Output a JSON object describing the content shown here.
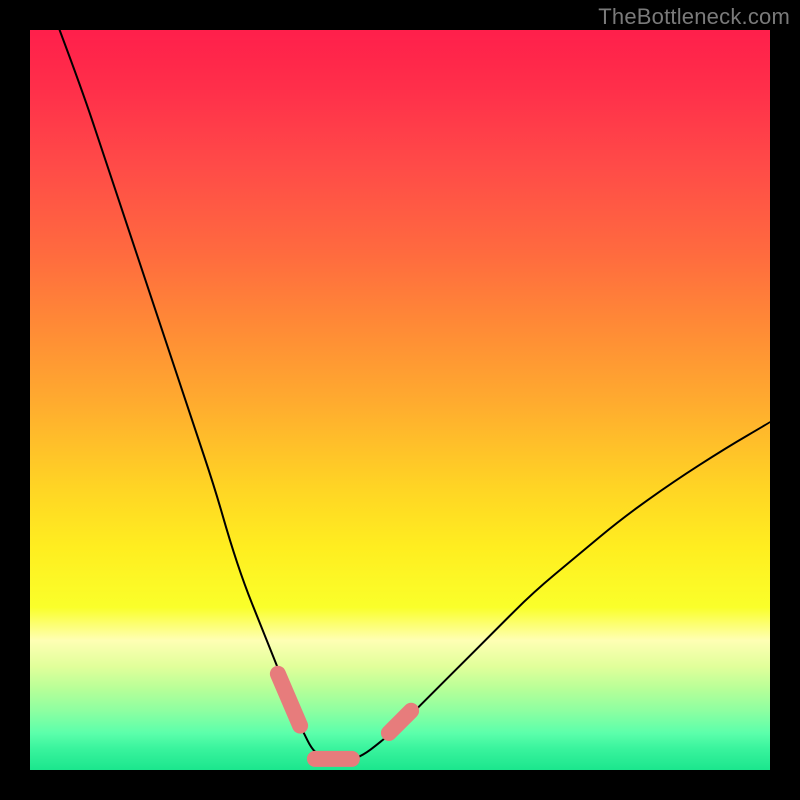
{
  "watermark": "TheBottleneck.com",
  "chart_data": {
    "type": "line",
    "title": "",
    "xlabel": "",
    "ylabel": "",
    "xlim": [
      0,
      100
    ],
    "ylim": [
      0,
      100
    ],
    "grid": false,
    "legend": false,
    "background_gradient": {
      "direction": "vertical",
      "stops": [
        {
          "pos": 0,
          "color": "#ff1f4b"
        },
        {
          "pos": 50,
          "color": "#ffaa2f"
        },
        {
          "pos": 78,
          "color": "#faff2a"
        },
        {
          "pos": 100,
          "color": "#1be68d"
        }
      ]
    },
    "series": [
      {
        "name": "bottleneck-curve",
        "color": "#000000",
        "x": [
          4,
          7,
          10,
          13,
          16,
          19,
          22,
          25,
          27,
          29,
          31,
          33,
          35,
          36,
          37,
          38,
          39,
          40,
          41,
          43,
          45,
          47,
          50,
          54,
          58,
          63,
          68,
          74,
          80,
          87,
          94,
          100
        ],
        "y": [
          100,
          92,
          83,
          74,
          65,
          56,
          47,
          38,
          31,
          25,
          20,
          15,
          10,
          7,
          5,
          3,
          2,
          1.2,
          1,
          1.2,
          2,
          3.5,
          6,
          10,
          14,
          19,
          24,
          29,
          34,
          39,
          43.5,
          47
        ]
      }
    ],
    "annotations": [
      {
        "name": "left-highlight-segment",
        "type": "line-segment",
        "color": "#e77c7c",
        "points": [
          {
            "x": 33.5,
            "y": 13
          },
          {
            "x": 36.5,
            "y": 6
          }
        ]
      },
      {
        "name": "trough-highlight-segment",
        "type": "line-segment",
        "color": "#e77c7c",
        "points": [
          {
            "x": 38.5,
            "y": 1.5
          },
          {
            "x": 43.5,
            "y": 1.5
          }
        ]
      },
      {
        "name": "right-highlight-segment",
        "type": "line-segment",
        "color": "#e77c7c",
        "points": [
          {
            "x": 48.5,
            "y": 5
          },
          {
            "x": 51.5,
            "y": 8
          }
        ]
      }
    ]
  }
}
